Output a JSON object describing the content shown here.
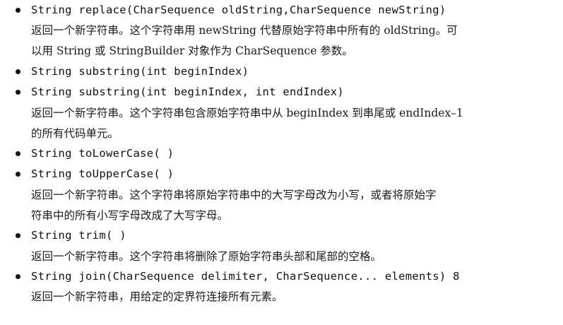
{
  "entries": [
    {
      "signature": "String replace(CharSequence oldString,CharSequence newString)",
      "description": [
        "返回一个新字符串。这个字符串用 newString 代替原始字符串中所有的 oldString。可",
        "以用 String 或 StringBuilder 对象作为 CharSequence 参数。"
      ]
    },
    {
      "signature": "String substring(int beginIndex)",
      "description": []
    },
    {
      "signature": "String substring(int beginIndex, int endIndex)",
      "description": [
        "返回一个新字符串。这个字符串包含原始字符串中从 beginIndex 到串尾或 endIndex–1",
        "的所有代码单元。"
      ]
    },
    {
      "signature": "String toLowerCase( )",
      "description": []
    },
    {
      "signature": "String toUpperCase( )",
      "description": [
        "返回一个新字符串。这个字符串将原始字符串中的大写字母改为小写，或者将原始字",
        "符串中的所有小写字母改成了大写字母。"
      ]
    },
    {
      "signature": "String trim( )",
      "description": [
        "返回一个新字符串。这个字符串将删除了原始字符串头部和尾部的空格。"
      ]
    },
    {
      "signature": "String join(CharSequence delimiter, CharSequence... elements) 8",
      "description": [
        "返回一个新字符串，用给定的定界符连接所有元素。"
      ]
    }
  ]
}
